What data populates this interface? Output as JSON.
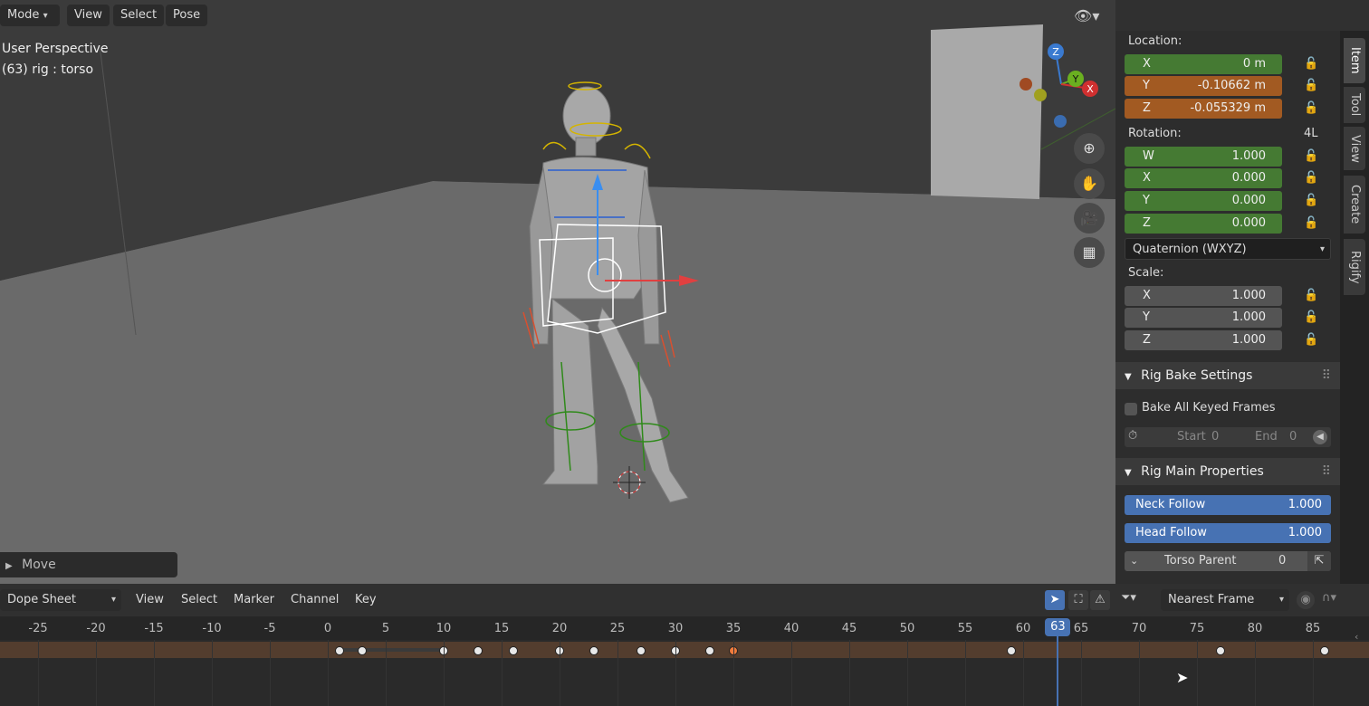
{
  "viewport": {
    "mode_label": "Mode",
    "menu": [
      "View",
      "Select",
      "Pose"
    ],
    "view_name": "User Perspective",
    "object_info": "(63) rig : torso",
    "last_op": "Move",
    "gizmo_axes": {
      "z": "Z",
      "y": "Y",
      "x": "X"
    }
  },
  "npanel": {
    "location_label": "Location:",
    "location": [
      {
        "axis": "X",
        "value": "0 m"
      },
      {
        "axis": "Y",
        "value": "-0.10662 m"
      },
      {
        "axis": "Z",
        "value": "-0.055329 m"
      }
    ],
    "rotation_label": "Rotation:",
    "rotation_mode_short": "4L",
    "rotation": [
      {
        "axis": "W",
        "value": "1.000"
      },
      {
        "axis": "X",
        "value": "0.000"
      },
      {
        "axis": "Y",
        "value": "0.000"
      },
      {
        "axis": "Z",
        "value": "0.000"
      }
    ],
    "rotation_mode": "Quaternion (WXYZ)",
    "scale_label": "Scale:",
    "scale": [
      {
        "axis": "X",
        "value": "1.000"
      },
      {
        "axis": "Y",
        "value": "1.000"
      },
      {
        "axis": "Z",
        "value": "1.000"
      }
    ],
    "rig_bake": {
      "title": "Rig Bake Settings",
      "bake_all": "Bake All Keyed Frames",
      "start_label": "Start",
      "start_value": "0",
      "end_label": "End",
      "end_value": "0"
    },
    "rig_main": {
      "title": "Rig Main Properties",
      "neck_label": "Neck Follow",
      "neck_value": "1.000",
      "head_label": "Head Follow",
      "head_value": "1.000",
      "torso_label": "Torso Parent",
      "torso_value": "0"
    },
    "tabs": [
      "Item",
      "Tool",
      "View",
      "Create",
      "Rigify"
    ]
  },
  "dope": {
    "editor": "Dope Sheet",
    "menu": [
      "View",
      "Select",
      "Marker",
      "Channel",
      "Key"
    ],
    "snap": "Nearest Frame",
    "current_frame": "63",
    "ticks": [
      "-25",
      "-20",
      "-15",
      "-10",
      "-5",
      "0",
      "5",
      "10",
      "15",
      "20",
      "25",
      "30",
      "35",
      "40",
      "45",
      "50",
      "55",
      "60",
      "65",
      "70",
      "75",
      "80",
      "85"
    ],
    "keyframes": [
      1,
      3,
      10,
      13,
      16,
      20,
      23,
      27,
      30,
      33,
      35,
      59,
      77,
      86
    ],
    "selected_keyframe": 35
  },
  "colors": {
    "accent_blue": "#4772b3",
    "field_green": "#457a33",
    "field_orange": "#a25a22",
    "keyframe_selected": "#f07b3c"
  }
}
